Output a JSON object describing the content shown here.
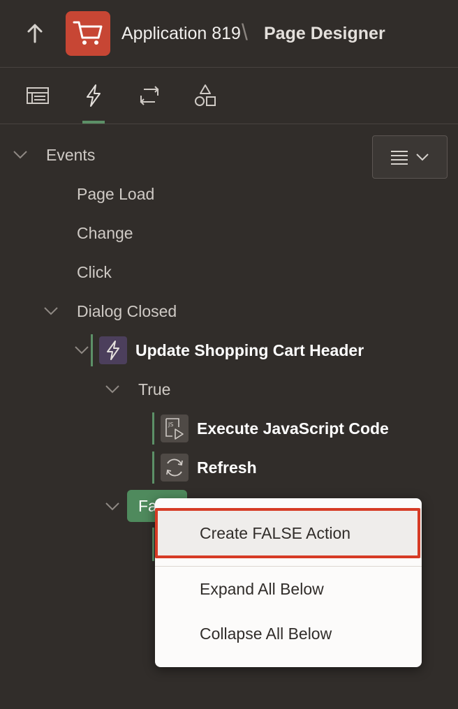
{
  "header": {
    "back_icon": "arrow-up-icon",
    "app_icon": "shopping-cart-icon",
    "app_icon_color": "#c74634",
    "app_name": "Application 819",
    "separator": "\\",
    "page_name": "Page Designer"
  },
  "tabs": [
    {
      "icon": "rendering-tree-icon",
      "active": false
    },
    {
      "icon": "dynamic-actions-icon",
      "active": true
    },
    {
      "icon": "processing-icon",
      "active": false
    },
    {
      "icon": "shared-components-icon",
      "active": false
    }
  ],
  "tree": {
    "root": "Events",
    "events": [
      "Page Load",
      "Change",
      "Click",
      "Dialog Closed"
    ],
    "dynamic_action": "Update Shopping Cart Header",
    "true_branch": "True",
    "true_actions": [
      "Execute JavaScript Code",
      "Refresh"
    ],
    "false_branch": "False"
  },
  "context_menu": {
    "items": [
      "Create FALSE Action",
      "Expand All Below",
      "Collapse All Below"
    ],
    "highlighted": "Create FALSE Action"
  },
  "colors": {
    "background": "#312d2a",
    "accent_green": "#5c9067",
    "focus_red": "#d63b25"
  }
}
